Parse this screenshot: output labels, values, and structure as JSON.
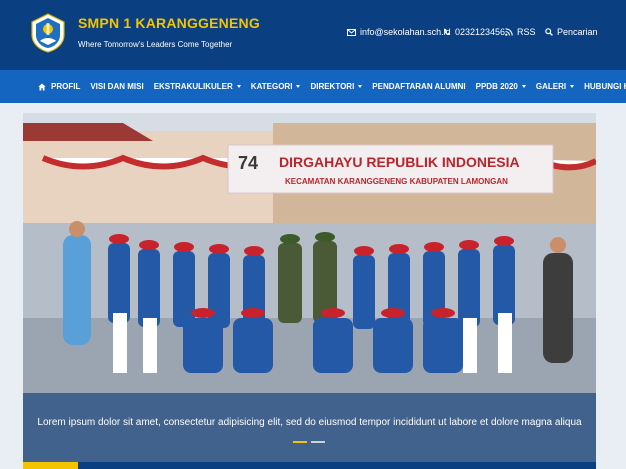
{
  "header": {
    "title": "SMPN 1 KARANGGENENG",
    "tagline": "Where Tomorrow's Leaders Come Together",
    "email": "info@sekolahan.sch.id",
    "phone": "0232123456",
    "rss": "RSS",
    "search": "Pencarian"
  },
  "nav": {
    "items": [
      {
        "label": "PROFIL",
        "dropdown": false
      },
      {
        "label": "VISI DAN MISI",
        "dropdown": false
      },
      {
        "label": "EKSTRAKULIKULER",
        "dropdown": true
      },
      {
        "label": "KATEGORI",
        "dropdown": true
      },
      {
        "label": "DIREKTORI",
        "dropdown": true
      },
      {
        "label": "PENDAFTARAN ALUMNI",
        "dropdown": false
      },
      {
        "label": "PPDB 2020",
        "dropdown": true
      },
      {
        "label": "GALERI",
        "dropdown": true
      },
      {
        "label": "HUBUNGI KAMI",
        "dropdown": false
      }
    ]
  },
  "slider": {
    "banner_main": "DIRGAHAYU REPUBLIK INDONESIA",
    "banner_sub": "KECAMATAN KARANGGENENG KABUPATEN LAMONGAN",
    "banner_number": "74",
    "caption": "Lorem ipsum dolor sit amet, consectetur adipisicing elit, sed do eiusmod tempor incididunt ut labore et dolore magna aliqua",
    "active_slide": 1,
    "slide_count": 2
  },
  "colors": {
    "header_bg": "#0a3f82",
    "nav_bg": "#1465c0",
    "accent": "#f5c400"
  }
}
